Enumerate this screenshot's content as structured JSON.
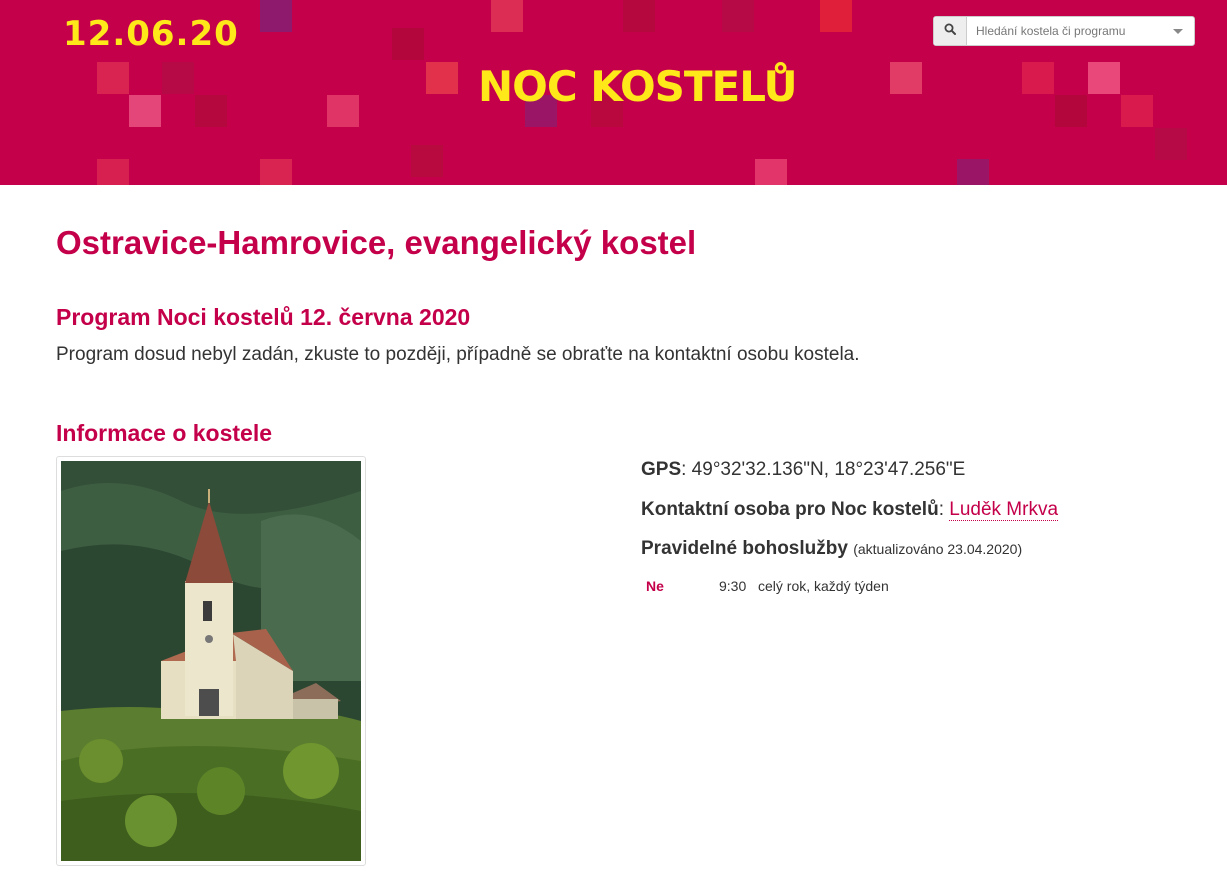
{
  "header": {
    "date": "12.06.20",
    "logo": "NOC KOSTELŮ",
    "search_placeholder": "Hledání kostela či programu",
    "colors": {
      "background": "#c4004a",
      "accent": "#ffe81a"
    }
  },
  "page": {
    "title": "Ostravice-Hamrovice, evangelický kostel"
  },
  "program": {
    "heading": "Program Noci kostelů 12. června 2020",
    "text": "Program dosud nebyl zadán, zkuste to později, případně se obraťte na kontaktní osobu kostela."
  },
  "info": {
    "heading": "Informace o kostele",
    "photo_icon": "church-photo",
    "gps_label": "GPS",
    "gps_value": ": 49°32'32.136\"N, 18°23'47.256\"E",
    "contact_label": "Kontaktní osoba pro Noc kostelů",
    "contact_sep": ": ",
    "contact_name": "Luděk Mrkva",
    "services_label": "Pravidelné bohoslužby",
    "services_updated": "(aktualizováno 23.04.2020)",
    "services": [
      {
        "day": "Ne",
        "time": "9:30",
        "note": "celý rok, každý týden"
      }
    ]
  }
}
